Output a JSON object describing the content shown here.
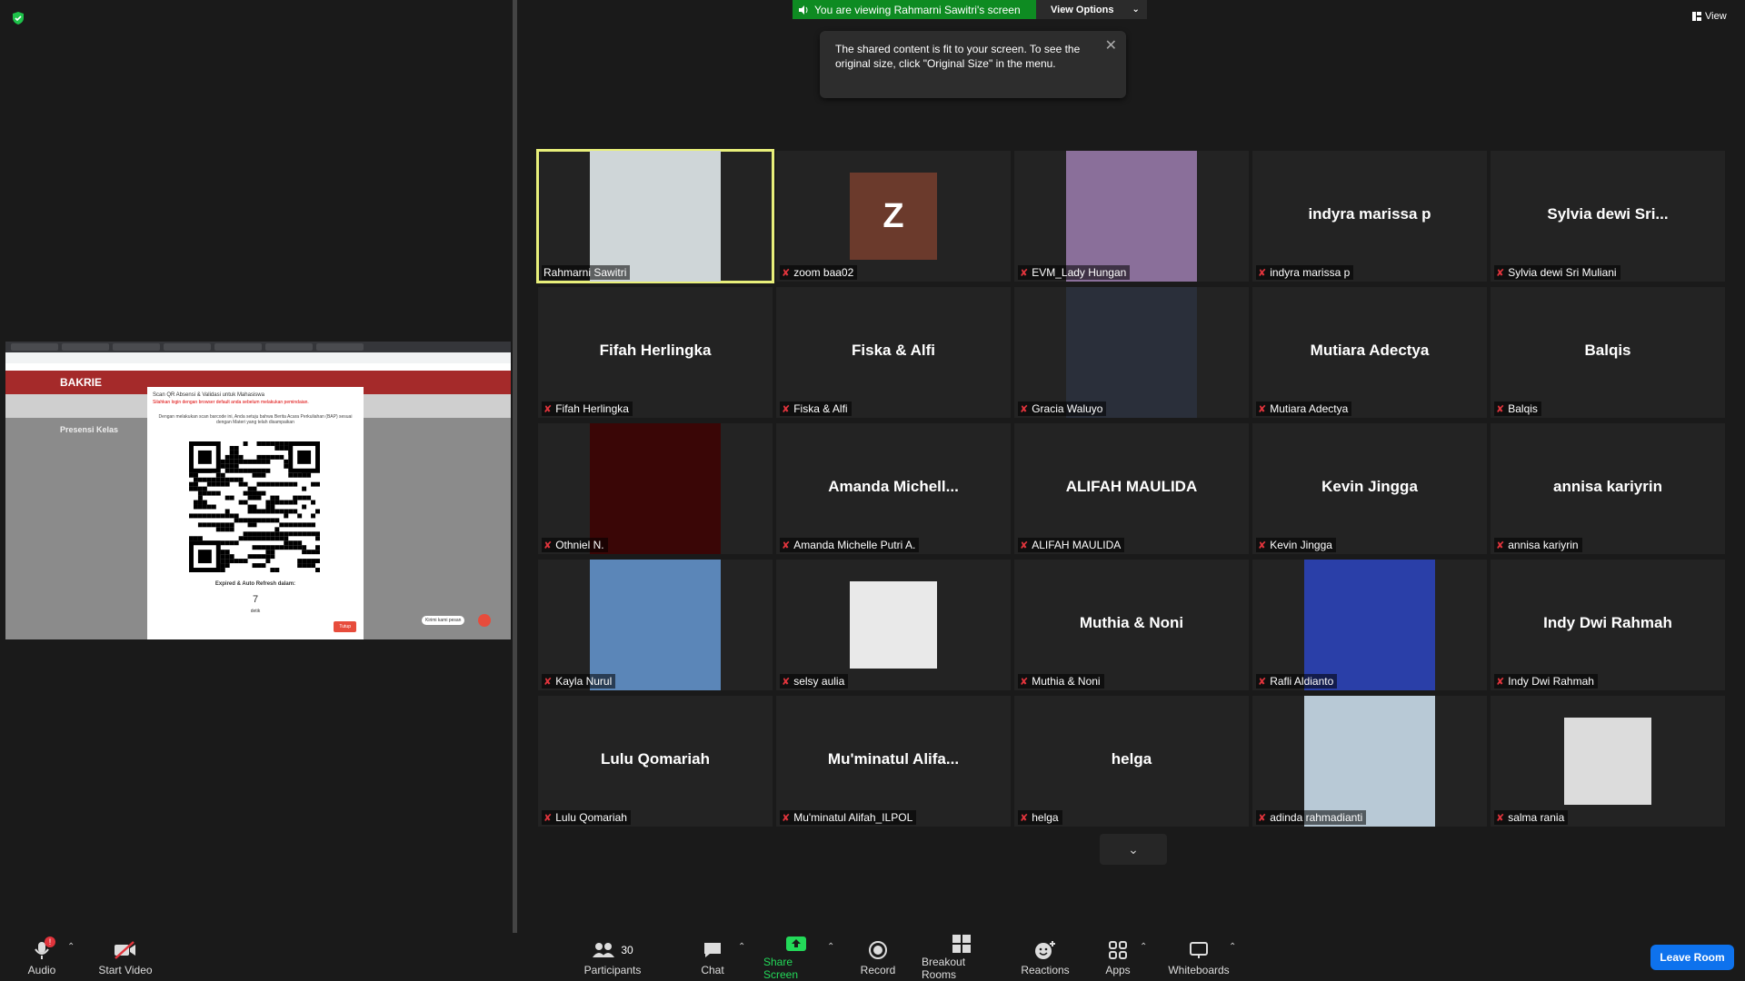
{
  "banner": {
    "viewing_text": "You are viewing Rahmarni Sawitri's screen",
    "view_options": "View Options",
    "view_label": "View"
  },
  "tooltip": {
    "text": "The shared content is fit to your screen. To see the original size, click \"Original Size\" in the menu."
  },
  "shared_screen": {
    "site_logo": "BAKRIE",
    "page_title": "Presensi Kelas",
    "modal_title": "Scan QR Absensi & Validasi untuk Mahasiswa",
    "modal_warning": "Silahkan login dengan browser default anda sebelum melakukan pemindaian.",
    "modal_text": "Dengan melakukan scan barcode ini, Anda setuju bahwa Berita Acara Perkuliahan (BAP) sesuai dengan Materi yang telah disampaikan",
    "expired_label": "Expired & Auto Refresh dalam:",
    "countdown": "7",
    "countdown_unit": "detik",
    "close_button": "Tutup",
    "chat_tooltip": "Kirimi kami pesan"
  },
  "participants": [
    {
      "name": "Rahmarni Sawitri",
      "display": "",
      "type": "photo",
      "active": true,
      "muted": false
    },
    {
      "name": "zoom baa02",
      "display": "",
      "type": "avatar",
      "initial": "Z",
      "muted": true
    },
    {
      "name": "EVM_Lady Hungan",
      "display": "",
      "type": "photo",
      "muted": true
    },
    {
      "name": "indyra marissa p",
      "display": "indyra marissa p",
      "type": "name",
      "muted": true
    },
    {
      "name": "Sylvia dewi Sri Muliani",
      "display": "Sylvia dewi Sri...",
      "type": "name",
      "muted": true
    },
    {
      "name": "Fifah Herlingka",
      "display": "Fifah Herlingka",
      "type": "name",
      "muted": true
    },
    {
      "name": "Fiska & Alfi",
      "display": "Fiska & Alfi",
      "type": "name",
      "muted": true
    },
    {
      "name": "Gracia Waluyo",
      "display": "",
      "type": "photo",
      "muted": true
    },
    {
      "name": "Mutiara Adectya",
      "display": "Mutiara Adectya",
      "type": "name",
      "muted": true
    },
    {
      "name": "Balqis",
      "display": "Balqis",
      "type": "name",
      "muted": true
    },
    {
      "name": "Othniel N.",
      "display": "",
      "type": "photo",
      "muted": true
    },
    {
      "name": "Amanda Michelle Putri A.",
      "display": "Amanda  Michell...",
      "type": "name",
      "muted": true
    },
    {
      "name": "ALIFAH MAULIDA",
      "display": "ALIFAH MAULIDA",
      "type": "name",
      "muted": true
    },
    {
      "name": "Kevin Jingga",
      "display": "Kevin Jingga",
      "type": "name",
      "muted": true
    },
    {
      "name": "annisa kariyrin",
      "display": "annisa kariyrin",
      "type": "name",
      "muted": true
    },
    {
      "name": "Kayla Nurul",
      "display": "",
      "type": "photo",
      "muted": true
    },
    {
      "name": "selsy aulia",
      "display": "",
      "type": "photo",
      "muted": true
    },
    {
      "name": "Muthia & Noni",
      "display": "Muthia & Noni",
      "type": "name",
      "muted": true
    },
    {
      "name": "Rafli Aldianto",
      "display": "",
      "type": "photo",
      "muted": true
    },
    {
      "name": "Indy Dwi Rahmah",
      "display": "Indy Dwi Rahmah",
      "type": "name",
      "muted": true
    },
    {
      "name": "Lulu Qomariah",
      "display": "Lulu Qomariah",
      "type": "name",
      "muted": true
    },
    {
      "name": "Mu'minatul Alifah_ILPOL",
      "display": "Mu'minatul  Alifa...",
      "type": "name",
      "muted": true
    },
    {
      "name": "helga",
      "display": "helga",
      "type": "name",
      "muted": true
    },
    {
      "name": "adinda rahmadianti",
      "display": "",
      "type": "photo",
      "muted": true
    },
    {
      "name": "salma rania",
      "display": "",
      "type": "photo",
      "muted": true
    }
  ],
  "toolbar": {
    "audio": "Audio",
    "audio_badge": "!",
    "video": "Start Video",
    "participants": "Participants",
    "participants_count": "30",
    "chat": "Chat",
    "share": "Share Screen",
    "record": "Record",
    "breakout": "Breakout Rooms",
    "reactions": "Reactions",
    "apps": "Apps",
    "whiteboards": "Whiteboards",
    "leave": "Leave Room"
  },
  "colors": {
    "share_green": "#0e8b22",
    "leave_blue": "#0e72ed",
    "active_border": "#e8ef7a",
    "muted_red": "#e0343c"
  }
}
